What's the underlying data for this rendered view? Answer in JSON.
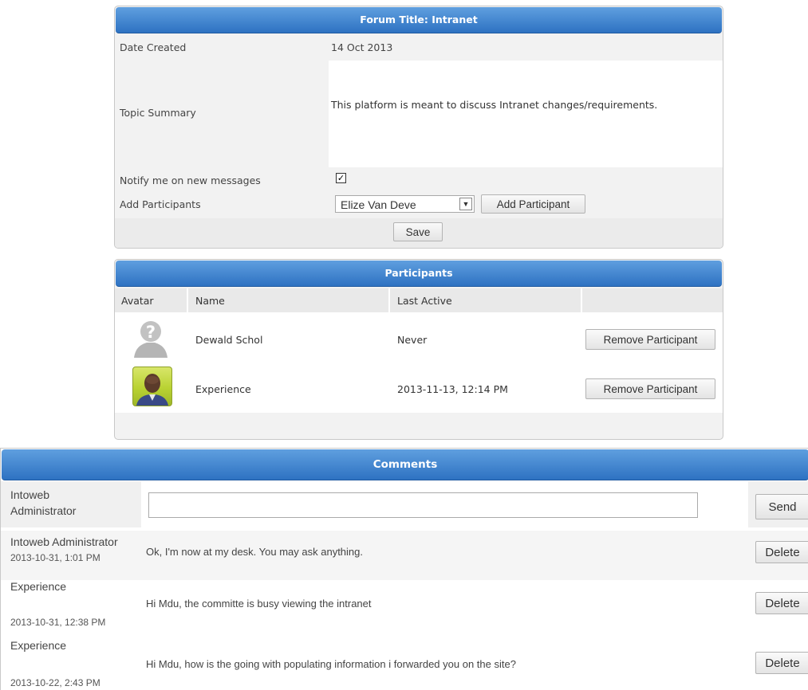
{
  "forum": {
    "title": "Forum Title: Intranet",
    "date_created_label": "Date Created",
    "date_created_value": "14 Oct 2013",
    "topic_summary_label": "Topic Summary",
    "topic_summary_value": "This platform is meant to discuss  Intranet changes/requirements.",
    "notify_label": "Notify me on new messages",
    "notify_checked": true,
    "add_participants_label": "Add Participants",
    "participant_select_value": "Elize Van Deve",
    "add_participant_button": "Add Participant",
    "save_button": "Save"
  },
  "participants": {
    "title": "Participants",
    "columns": [
      "Avatar",
      "Name",
      "Last Active"
    ],
    "rows": [
      {
        "avatar": "default-avatar-icon",
        "name": "Dewald Schol",
        "last_active": "Never",
        "action": "Remove Participant"
      },
      {
        "avatar": "user-photo",
        "name": "Experience",
        "last_active": "2013-11-13, 12:14 PM",
        "action": "Remove Participant"
      }
    ]
  },
  "comments": {
    "title": "Comments",
    "composer_author_line1": "Intoweb",
    "composer_author_line2": "Administrator",
    "composer_placeholder": "",
    "send_button": "Send",
    "items": [
      {
        "author": "Intoweb Administrator",
        "date": "2013-10-31, 1:01 PM",
        "text": "Ok, I'm now at my desk. You may ask anything.",
        "action": "Delete"
      },
      {
        "author": "Experience",
        "date": "2013-10-31, 12:38 PM",
        "text": "Hi Mdu, the committe is busy viewing the intranet",
        "action": "Delete"
      },
      {
        "author": "Experience",
        "date": "2013-10-22, 2:43 PM",
        "text": "Hi Mdu, how is the going with populating information i forwarded you on the site?",
        "action": "Delete"
      }
    ]
  },
  "colors": {
    "header_top": "#5f9fdf",
    "header_bottom": "#2e72c2",
    "panel_bg": "#f2f2f2"
  }
}
